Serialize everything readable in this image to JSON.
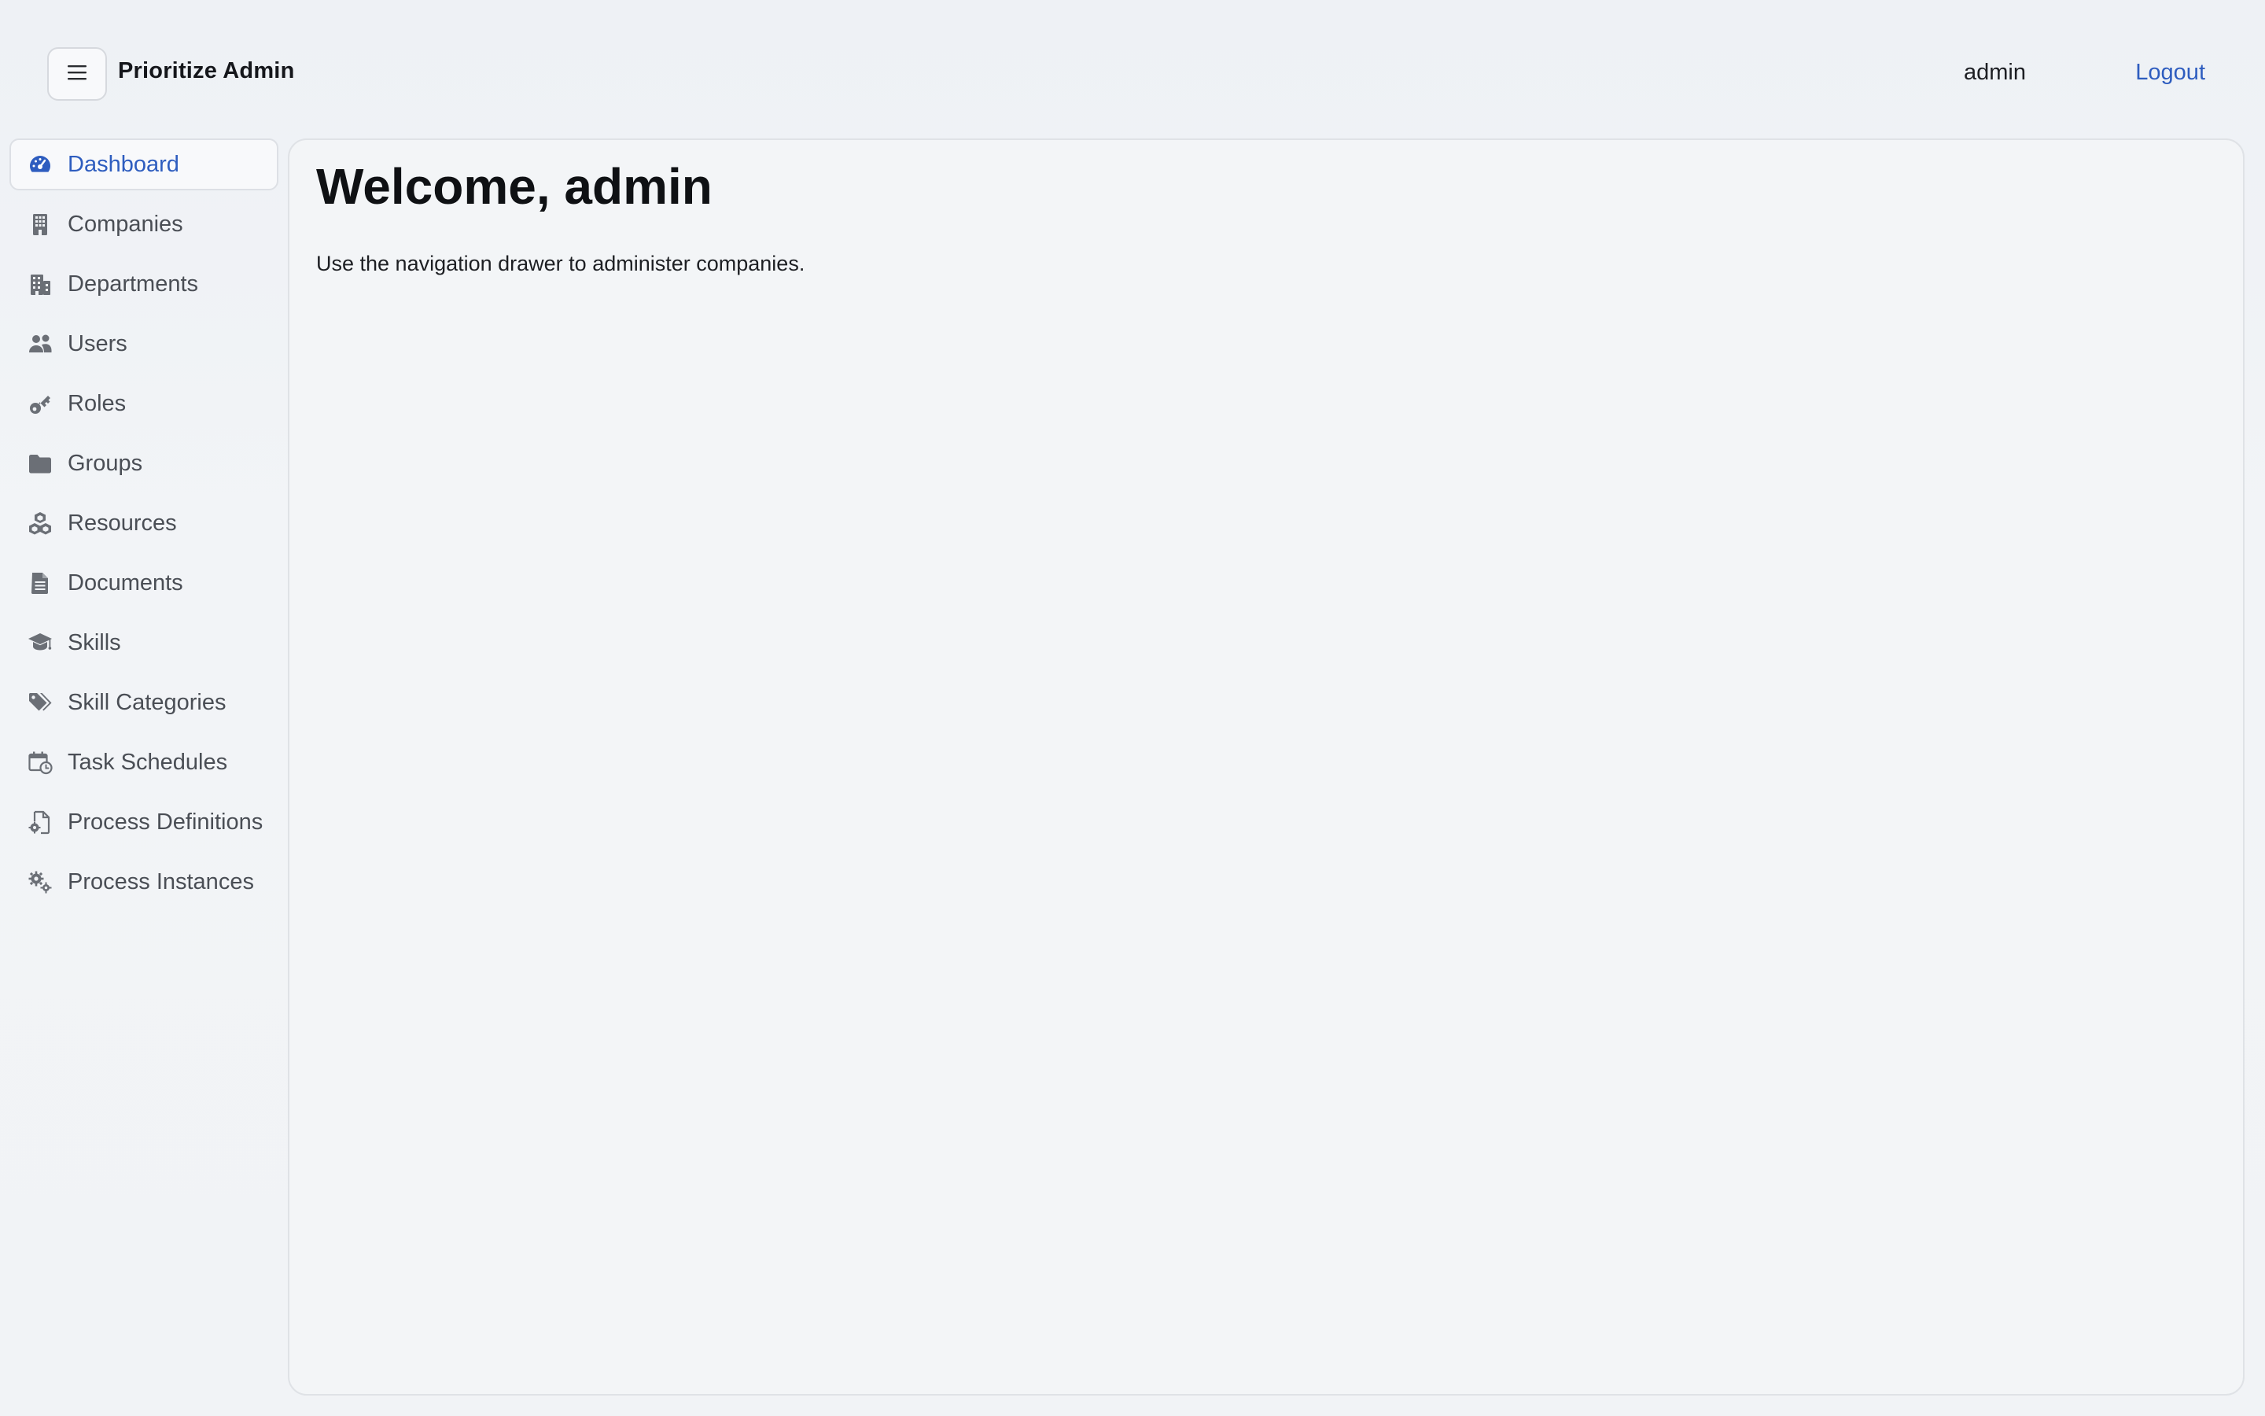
{
  "header": {
    "app_title": "Prioritize Admin",
    "user_name": "admin",
    "logout_label": "Logout"
  },
  "sidebar": {
    "items": [
      {
        "label": "Dashboard",
        "icon": "dashboard-gauge-icon",
        "active": true
      },
      {
        "label": "Companies",
        "icon": "building-icon",
        "active": false
      },
      {
        "label": "Departments",
        "icon": "buildings-icon",
        "active": false
      },
      {
        "label": "Users",
        "icon": "users-icon",
        "active": false
      },
      {
        "label": "Roles",
        "icon": "key-icon",
        "active": false
      },
      {
        "label": "Groups",
        "icon": "folder-icon",
        "active": false
      },
      {
        "label": "Resources",
        "icon": "cubes-icon",
        "active": false
      },
      {
        "label": "Documents",
        "icon": "document-icon",
        "active": false
      },
      {
        "label": "Skills",
        "icon": "graduation-cap-icon",
        "active": false
      },
      {
        "label": "Skill Categories",
        "icon": "tags-icon",
        "active": false
      },
      {
        "label": "Task Schedules",
        "icon": "calendar-clock-icon",
        "active": false
      },
      {
        "label": "Process Definitions",
        "icon": "file-gear-icon",
        "active": false
      },
      {
        "label": "Process Instances",
        "icon": "gears-icon",
        "active": false
      }
    ]
  },
  "main": {
    "heading": "Welcome, admin",
    "description": "Use the navigation drawer to administer companies."
  },
  "colors": {
    "accent": "#2e5dbf",
    "nav_text": "#4a4e55",
    "icon_gray": "#6b6f76",
    "background": "#f1f3f6"
  }
}
